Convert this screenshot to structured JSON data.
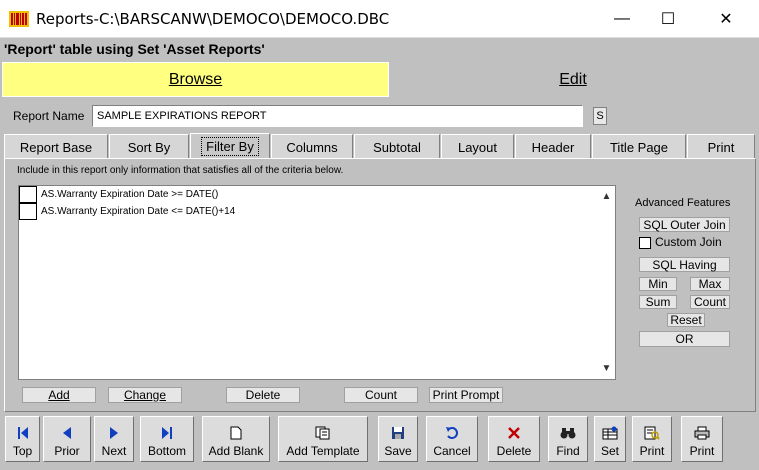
{
  "window": {
    "title": "Reports-C:\\BARSCANW\\DEMOCO\\DEMOCO.DBC",
    "min_glyph": "—",
    "max_glyph": "☐",
    "close_glyph": "✕"
  },
  "subheader": "'Report' table using Set 'Asset Reports'",
  "nav": {
    "browse": "Browse",
    "edit": "Edit"
  },
  "report_name": {
    "label": "Report Name",
    "value": "SAMPLE EXPIRATIONS REPORT",
    "s_button": "S"
  },
  "tabs": [
    {
      "label": "Report Base"
    },
    {
      "label": "Sort By"
    },
    {
      "label": "Filter By"
    },
    {
      "label": "Columns"
    },
    {
      "label": "Subtotal"
    },
    {
      "label": "Layout"
    },
    {
      "label": "Header"
    },
    {
      "label": "Title Page"
    },
    {
      "label": "Print"
    }
  ],
  "panel": {
    "note": "Include in this report only information that satisfies all of the criteria below.",
    "criteria": [
      "AS.Warranty Expiration Date >= DATE()",
      "AS.Warranty Expiration Date <= DATE()+14"
    ]
  },
  "advanced": {
    "title": "Advanced Features",
    "sql_outer_join": "SQL Outer Join",
    "custom_join": "Custom Join",
    "sql_having": "SQL Having",
    "min": "Min",
    "max": "Max",
    "sum": "Sum",
    "count": "Count",
    "reset": "Reset",
    "or": "OR"
  },
  "actions": {
    "add": "Add",
    "change": "Change",
    "delete": "Delete",
    "count": "Count",
    "print_prompt": "Print Prompt"
  },
  "toolbar": {
    "top": "Top",
    "prior": "Prior",
    "next": "Next",
    "bottom": "Bottom",
    "add_blank": "Add Blank",
    "add_template": "Add Template",
    "save": "Save",
    "cancel": "Cancel",
    "delete": "Delete",
    "find": "Find",
    "set": "Set",
    "print1": "Print",
    "print2": "Print"
  },
  "colors": {
    "browse_bg": "#ffff80",
    "window_bg": "#c0c0c0",
    "icon_blue": "#1040c0",
    "icon_red": "#c00000"
  }
}
